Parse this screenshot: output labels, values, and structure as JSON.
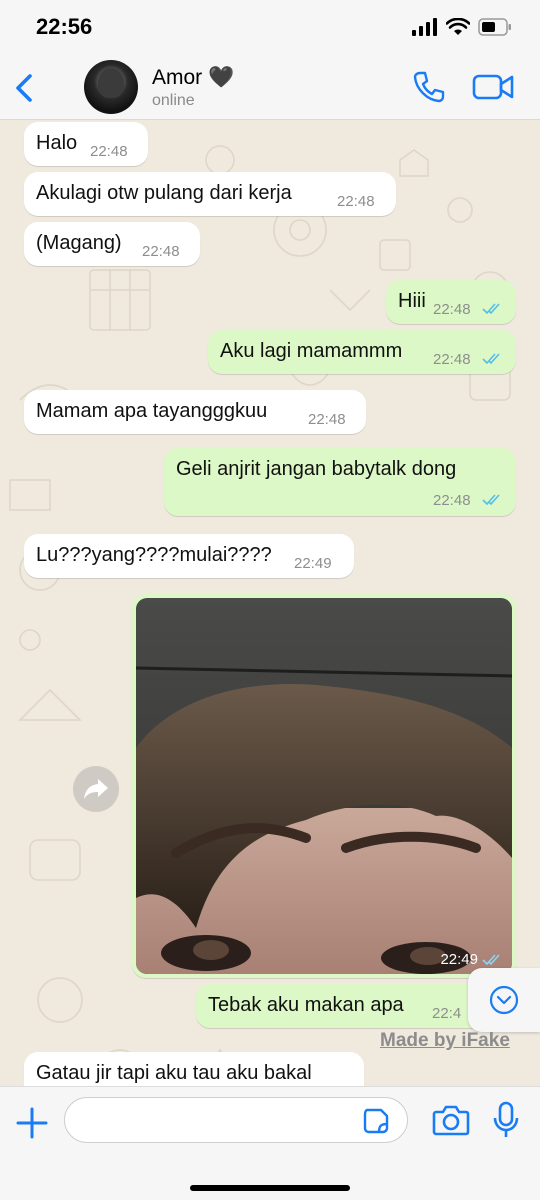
{
  "status_bar": {
    "time": "22:56"
  },
  "header": {
    "contact_name": "Amor 🖤",
    "contact_status": "online"
  },
  "messages": [
    {
      "text": "Halo",
      "time": "22:48"
    },
    {
      "text": "Akulagi otw pulang dari kerja",
      "time": "22:48"
    },
    {
      "text": "(Magang)",
      "time": "22:48"
    },
    {
      "text": "Hiii",
      "time": "22:48"
    },
    {
      "text": "Aku lagi mamammm",
      "time": "22:48"
    },
    {
      "text": "Mamam apa tayangggkuu",
      "time": "22:48"
    },
    {
      "text": "Geli anjrit jangan babytalk dong",
      "time": "22:48"
    },
    {
      "text": "Lu???yang????mulai????",
      "time": "22:49"
    },
    {
      "text": "",
      "time": "22:49"
    },
    {
      "text": "Tebak aku makan apa",
      "time": "22:4"
    },
    {
      "text": "Gatau jir tapi aku tau aku bakal",
      "time": ""
    }
  ],
  "watermark": "Made by iFake",
  "composer": {
    "placeholder": ""
  },
  "colors": {
    "accent": "#1a7cf5",
    "outgoing_bubble": "#dcf8c6",
    "incoming_bubble": "#ffffff",
    "chat_background": "#efe9de",
    "read_ticks": "#53bdeb"
  },
  "icons": [
    "back-chevron-icon",
    "phone-icon",
    "video-icon",
    "forward-icon",
    "chevron-down-icon",
    "plus-icon",
    "sticker-icon",
    "camera-icon",
    "microphone-icon",
    "signal-icon",
    "wifi-icon",
    "battery-icon"
  ]
}
